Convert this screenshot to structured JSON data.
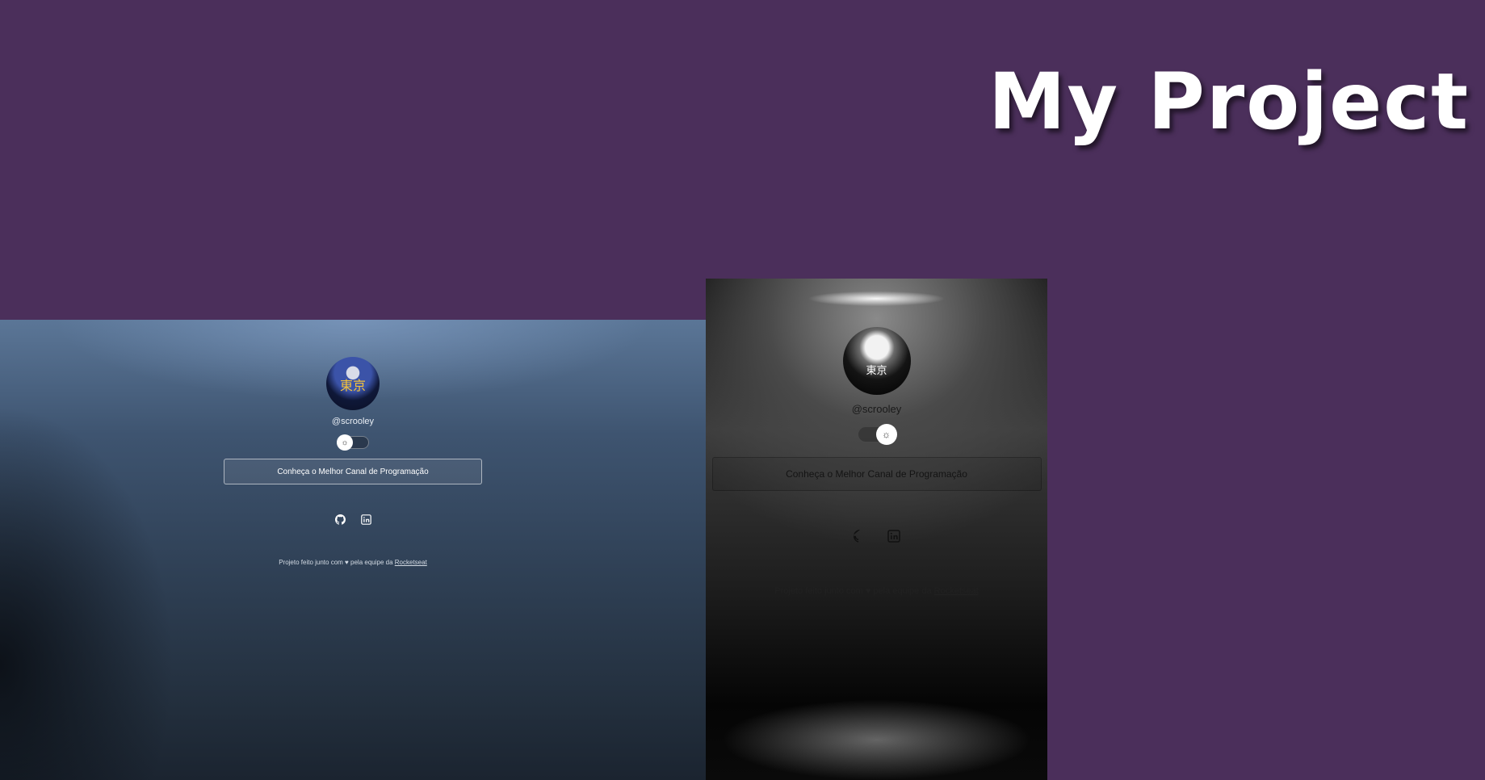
{
  "banner": {
    "title": "My Project"
  },
  "left_preview": {
    "theme": "dark-blue",
    "avatar": {
      "glyph": "東京"
    },
    "username": "@scrooley",
    "toggle": {
      "state": "left",
      "icon": "sun-icon"
    },
    "cta_label": "Conheça o Melhor Canal de Programação",
    "social": [
      {
        "icon": "github-icon"
      },
      {
        "icon": "linkedin-icon"
      }
    ],
    "footer": {
      "prefix": "Projeto feito junto com",
      "heart": "♥",
      "middle": "pela equipe da",
      "link": "Rocketseat"
    }
  },
  "right_preview": {
    "theme": "light-spotlight",
    "avatar": {
      "glyph": "東京"
    },
    "username": "@scrooley",
    "toggle": {
      "state": "right",
      "icon": "sun-icon"
    },
    "cta_label": "Conheça o Melhor Canal de Programação",
    "social": [
      {
        "icon": "github-icon"
      },
      {
        "icon": "linkedin-icon"
      }
    ],
    "footer": {
      "prefix": "Projeto feito junto com",
      "heart": "♥",
      "middle": "pela equipe da",
      "link": "Rocketseat"
    }
  },
  "colors": {
    "background": "#4b2f5b",
    "title": "#ffffff"
  }
}
